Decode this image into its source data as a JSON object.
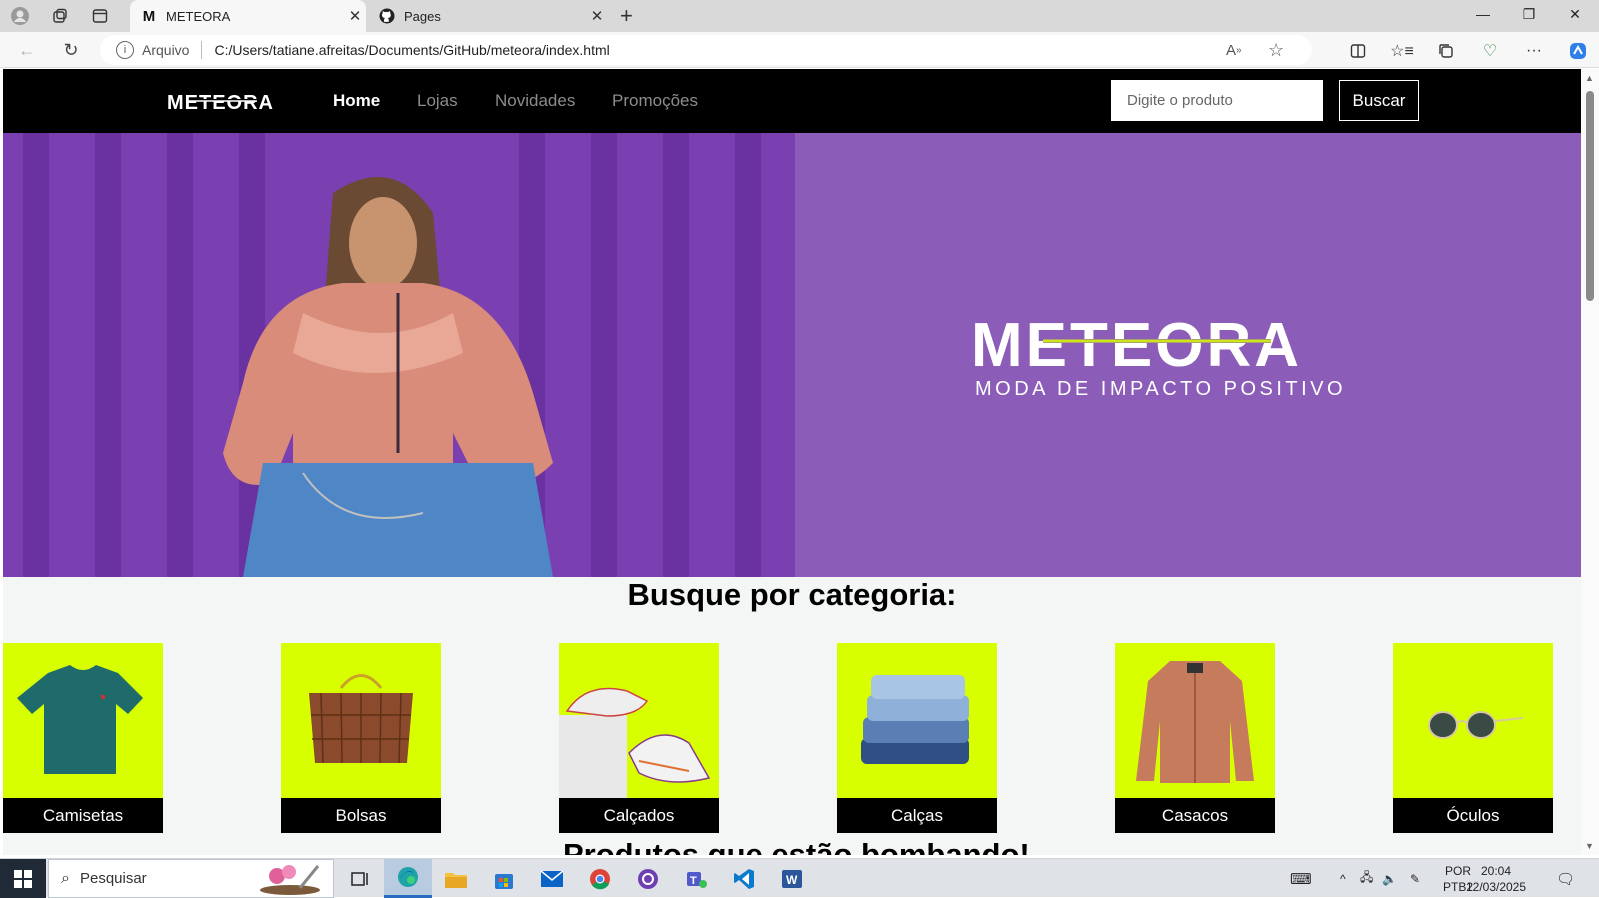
{
  "browser": {
    "tabs": [
      {
        "title": "METEORA",
        "favicon": "M",
        "active": true
      },
      {
        "title": "Pages",
        "favicon": "github-icon",
        "active": false
      }
    ],
    "address": {
      "scheme_label": "Arquivo",
      "url": "C:/Users/tatiane.afreitas/Documents/GitHub/meteora/index.html"
    }
  },
  "site": {
    "logo_text": "METEORA",
    "nav": [
      {
        "label": "Home",
        "active": true
      },
      {
        "label": "Lojas",
        "active": false
      },
      {
        "label": "Novidades",
        "active": false
      },
      {
        "label": "Promoções",
        "active": false
      }
    ],
    "search": {
      "placeholder": "Digite o produto",
      "button_label": "Buscar"
    },
    "hero": {
      "brand": "METEORA",
      "tagline": "MODA DE IMPACTO POSITIVO"
    },
    "categories_title": "Busque por categoria:",
    "categories": [
      "Camisetas",
      "Bolsas",
      "Calçados",
      "Calças",
      "Casacos",
      "Óculos"
    ],
    "next_section_peek": "Produtos que estão bombando!",
    "colors": {
      "header_bg": "#000000",
      "hero_bg": "#8c5db8",
      "accent_lime": "#d8ff00"
    }
  },
  "taskbar": {
    "search_placeholder": "Pesquisar",
    "lang_line1": "POR",
    "lang_line2": "PTB2",
    "time": "20:04",
    "date": "12/03/2025"
  }
}
